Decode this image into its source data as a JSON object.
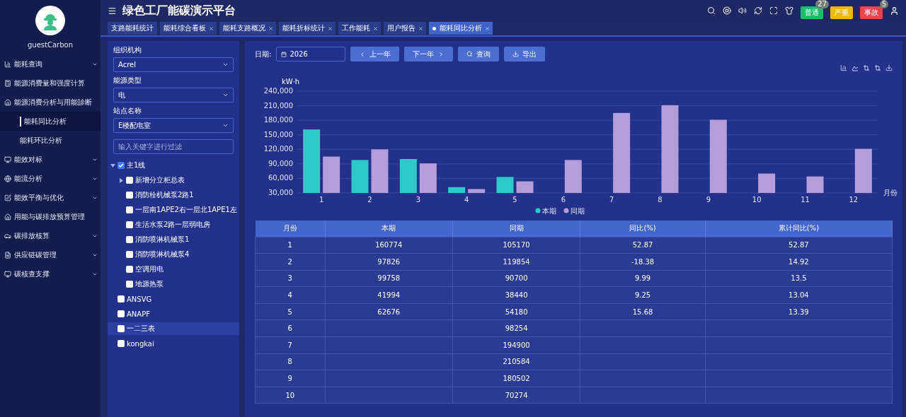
{
  "user": {
    "name": "guestCarbon"
  },
  "header": {
    "title": "绿色工厂能碳演示平台",
    "alerts": [
      {
        "label": "普通",
        "count": "27",
        "color": "#19be6b"
      },
      {
        "label": "严重",
        "color": "#f5b800"
      },
      {
        "label": "事故",
        "count": "5",
        "color": "#e8454d"
      }
    ]
  },
  "tabs": [
    {
      "label": "支路能耗统计",
      "selected": false,
      "closable": false
    },
    {
      "label": "能耗综合看板",
      "selected": false,
      "closable": true
    },
    {
      "label": "能耗支路概况",
      "selected": false,
      "closable": true
    },
    {
      "label": "能耗折标统计",
      "selected": false,
      "closable": true
    },
    {
      "label": "工作能耗",
      "selected": false,
      "closable": true
    },
    {
      "label": "用户报告",
      "selected": false,
      "closable": true
    },
    {
      "label": "能耗同比分析",
      "selected": true,
      "closable": true
    }
  ],
  "menu": [
    {
      "label": "能耗查询",
      "expanded": false
    },
    {
      "label": "能源消费量和强度计算"
    },
    {
      "label": "能源消费分析与用能診断",
      "expanded": true,
      "children": [
        {
          "label": "能耗同比分析",
          "selected": true
        },
        {
          "label": "能耗环比分析",
          "selected": false
        }
      ]
    },
    {
      "label": "能效对标",
      "expanded": false
    },
    {
      "label": "能流分析",
      "expanded": false
    },
    {
      "label": "能效平衡与优化",
      "expanded": false
    },
    {
      "label": "用能与碳排放预算管理"
    },
    {
      "label": "碳排放核算",
      "expanded": false
    },
    {
      "label": "供应链碳管理",
      "expanded": false
    },
    {
      "label": "碳核查支撑",
      "expanded": false
    }
  ],
  "filters": [
    {
      "label": "组织机构",
      "value": "Acrel"
    },
    {
      "label": "能源类型",
      "value": "电"
    },
    {
      "label": "站点名称",
      "value": "E楼配电室"
    }
  ],
  "tree_search": {
    "placeholder": "输入关键字进行过滤"
  },
  "tree": [
    {
      "label": "主1线",
      "checked": true,
      "expanded": true,
      "selected": false,
      "children": [
        {
          "label": "新增分立柜总表",
          "checked": false,
          "expanded": false,
          "selected": false
        },
        {
          "label": "消防栓机械泵2路1",
          "checked": false,
          "selected": false
        },
        {
          "label": "一层南1APE2右一层北1APE1左",
          "checked": false,
          "selected": false
        },
        {
          "label": "生活水泵2路一层弱电房",
          "checked": false,
          "selected": false
        },
        {
          "label": "消防喷淋机械泵1",
          "checked": false,
          "selected": false
        },
        {
          "label": "消防喷淋机械泵4",
          "checked": false,
          "selected": false
        },
        {
          "label": "空调用电",
          "checked": false,
          "selected": false
        },
        {
          "label": "地源热泵",
          "checked": false,
          "selected": false
        }
      ]
    },
    {
      "label": "ANSVG",
      "checked": false,
      "selected": false
    },
    {
      "label": "ANAPF",
      "checked": false,
      "selected": false
    },
    {
      "label": "一二三表",
      "checked": false,
      "selected": true
    },
    {
      "label": "kongkai",
      "checked": false,
      "selected": false
    }
  ],
  "toolbar": {
    "date_label": "日期:",
    "date_value": "2026",
    "buttons": [
      {
        "label": "上一年",
        "kind": "prev"
      },
      {
        "label": "下一年",
        "kind": "next"
      },
      {
        "label": "查询",
        "kind": "search"
      },
      {
        "label": "导出",
        "kind": "export"
      }
    ]
  },
  "chart_data": {
    "type": "bar",
    "ylabel": "kW·h",
    "xlabel": "月份",
    "categories": [
      "1",
      "2",
      "3",
      "4",
      "5",
      "6",
      "7",
      "8",
      "9",
      "10",
      "11",
      "12"
    ],
    "series": [
      {
        "name": "本期",
        "color": "#2ecacb",
        "values": [
          161000,
          98000,
          100000,
          42000,
          63000,
          null,
          null,
          null,
          null,
          null,
          null,
          null
        ]
      },
      {
        "name": "同期",
        "color": "#b39ddb",
        "values": [
          105000,
          120000,
          91000,
          38000,
          54000,
          98000,
          195000,
          211000,
          181000,
          70000,
          64000,
          121000
        ]
      }
    ],
    "grid": true,
    "legend": true,
    "ylim": [
      30000,
      240000
    ],
    "yticks": [
      {
        "value": 30000,
        "label": "30,000"
      },
      {
        "value": 60000,
        "label": "60,000"
      },
      {
        "value": 90000,
        "label": "90,000"
      },
      {
        "value": 120000,
        "label": "120,000"
      },
      {
        "value": 150000,
        "label": "150,000"
      },
      {
        "value": 180000,
        "label": "180,000"
      },
      {
        "value": 210000,
        "label": "210,000"
      },
      {
        "value": 240000,
        "label": "240,000"
      }
    ]
  },
  "table": {
    "columns": [
      "月份",
      "本期",
      "同期",
      "同比(%)",
      "累计同比(%)"
    ],
    "rows": [
      [
        "1",
        "160774",
        "105170",
        "52.87",
        "52.87"
      ],
      [
        "2",
        "97826",
        "119854",
        "-18.38",
        "14.92"
      ],
      [
        "3",
        "99758",
        "90700",
        "9.99",
        "13.5"
      ],
      [
        "4",
        "41994",
        "38440",
        "9.25",
        "13.04"
      ],
      [
        "5",
        "62676",
        "54180",
        "15.68",
        "13.39"
      ],
      [
        "6",
        "",
        "98254",
        "",
        ""
      ],
      [
        "7",
        "",
        "194900",
        "",
        ""
      ],
      [
        "8",
        "",
        "210584",
        "",
        ""
      ],
      [
        "9",
        "",
        "180502",
        "",
        ""
      ],
      [
        "10",
        "",
        "70274",
        "",
        ""
      ]
    ]
  }
}
